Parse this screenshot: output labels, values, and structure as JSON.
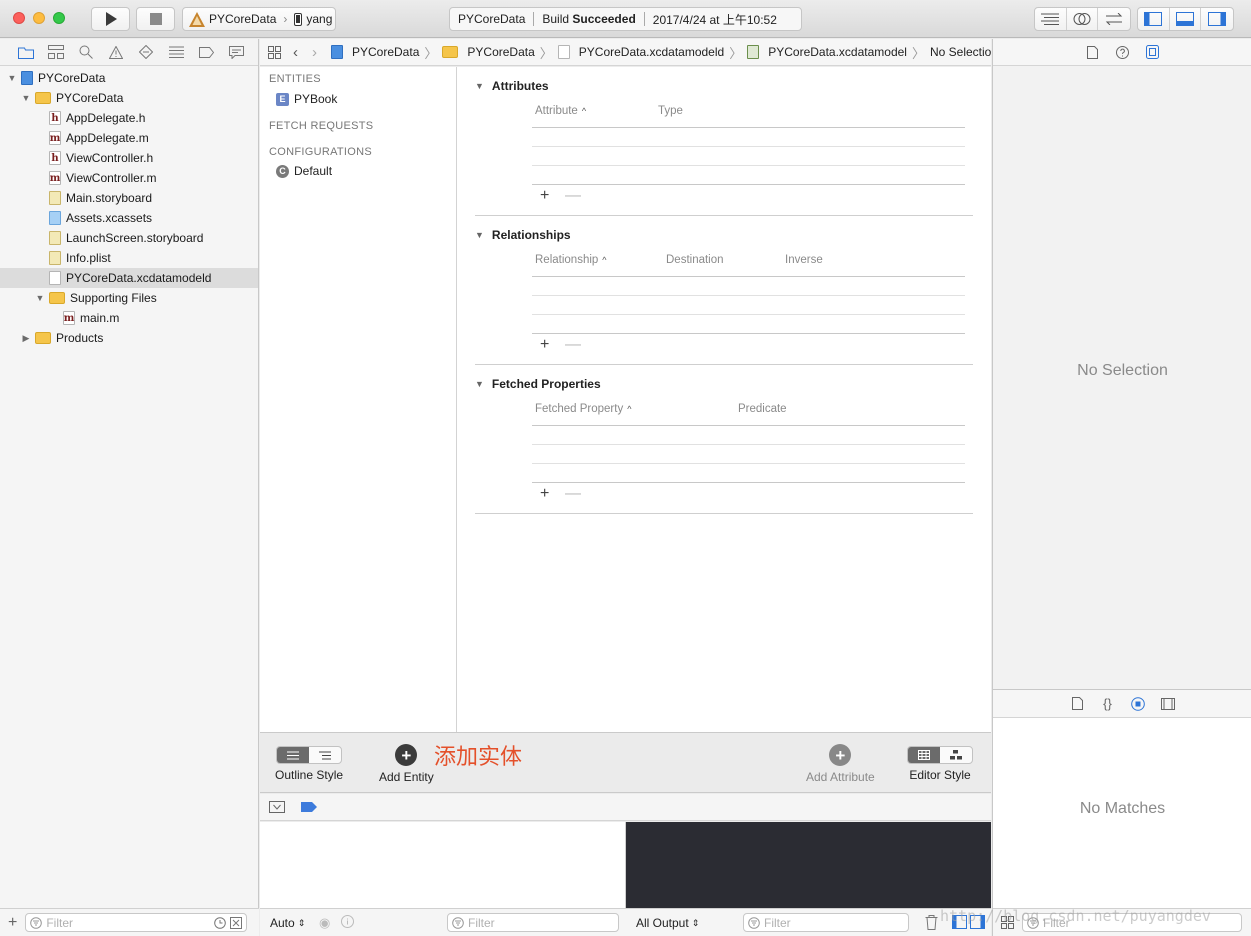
{
  "toolbar": {
    "scheme_target": "PYCoreData",
    "scheme_device": "yang",
    "activity_project": "PYCoreData",
    "activity_status_prefix": "Build",
    "activity_status": "Succeeded",
    "activity_time": "2017/4/24 at 上午10:52"
  },
  "navigator": {
    "items": [
      {
        "label": "PYCoreData",
        "kind": "proj",
        "depth": 0,
        "disclosure": "open"
      },
      {
        "label": "PYCoreData",
        "kind": "folder",
        "depth": 1,
        "disclosure": "open"
      },
      {
        "label": "AppDelegate.h",
        "kind": "file",
        "glyph": "h",
        "depth": 2
      },
      {
        "label": "AppDelegate.m",
        "kind": "file",
        "glyph": "m",
        "depth": 2
      },
      {
        "label": "ViewController.h",
        "kind": "file",
        "glyph": "h",
        "depth": 2
      },
      {
        "label": "ViewController.m",
        "kind": "file",
        "glyph": "m",
        "depth": 2
      },
      {
        "label": "Main.storyboard",
        "kind": "story",
        "depth": 2
      },
      {
        "label": "Assets.xcassets",
        "kind": "assets",
        "depth": 2
      },
      {
        "label": "LaunchScreen.storyboard",
        "kind": "story",
        "depth": 2
      },
      {
        "label": "Info.plist",
        "kind": "story",
        "depth": 2
      },
      {
        "label": "PYCoreData.xcdatamodeld",
        "kind": "file",
        "glyph": "",
        "depth": 2,
        "selected": true
      },
      {
        "label": "Supporting Files",
        "kind": "folder",
        "depth": 2,
        "disclosure": "open"
      },
      {
        "label": "main.m",
        "kind": "file",
        "glyph": "m",
        "depth": 3
      },
      {
        "label": "Products",
        "kind": "folder",
        "depth": 1,
        "disclosure": "closed"
      }
    ],
    "filter_placeholder": "Filter"
  },
  "jumpbar": {
    "crumbs": [
      "PYCoreData",
      "PYCoreData",
      "PYCoreData.xcdatamodeld",
      "PYCoreData.xcdatamodel",
      "No Selection"
    ]
  },
  "model": {
    "entities_title": "ENTITIES",
    "entity": "PYBook",
    "fetch_requests_title": "FETCH REQUESTS",
    "configurations_title": "CONFIGURATIONS",
    "configuration": "Default",
    "attributes": {
      "title": "Attributes",
      "col1": "Attribute",
      "col2": "Type"
    },
    "relationships": {
      "title": "Relationships",
      "col1": "Relationship",
      "col2": "Destination",
      "col3": "Inverse"
    },
    "fetched": {
      "title": "Fetched Properties",
      "col1": "Fetched Property",
      "col2": "Predicate"
    }
  },
  "bottom_toolbar": {
    "outline_style": "Outline Style",
    "add_entity": "Add Entity",
    "annotation": "添加实体",
    "add_attribute": "Add Attribute",
    "editor_style": "Editor Style"
  },
  "debug": {
    "auto_label": "Auto",
    "all_output_label": "All Output",
    "filter_placeholder": "Filter"
  },
  "inspector": {
    "no_selection": "No Selection",
    "no_matches": "No Matches",
    "filter_placeholder": "Filter"
  },
  "watermark": "http://blog.csdn.net/puyangdev"
}
